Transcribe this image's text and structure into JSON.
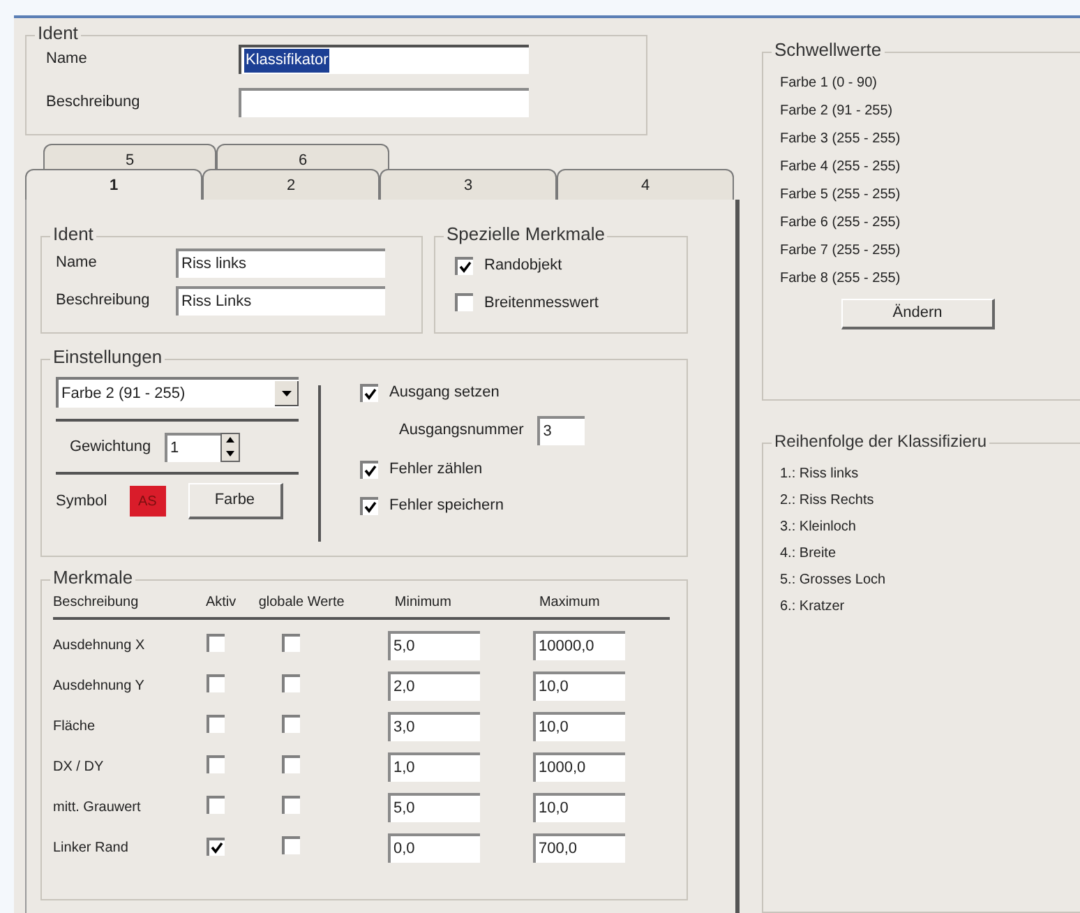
{
  "ident": {
    "title": "Ident",
    "fields": [
      {
        "label": "Name",
        "value": "Klassifikator",
        "selected": true
      },
      {
        "label": "Beschreibung",
        "selected": false
      }
    ]
  },
  "tab_rows": [
    {
      "tabs": [
        {
          "label": "5",
          "selected": false
        },
        {
          "label": "6",
          "selected": false
        }
      ]
    },
    {
      "tabs": [
        {
          "label": "1",
          "selected": true
        },
        {
          "label": "2",
          "selected": false
        },
        {
          "label": "3",
          "selected": false
        },
        {
          "label": "4",
          "selected": false
        }
      ]
    }
  ],
  "panel": {
    "ident": {
      "title": "Ident",
      "fields": [
        {
          "label": "Name",
          "value": "Riss links"
        },
        {
          "label": "Beschreibung",
          "value": "Riss Links"
        }
      ]
    },
    "special": {
      "title": "Spezielle Merkmale",
      "options": [
        {
          "label": "Randobjekt",
          "checked": true
        },
        {
          "label": "Breitenmesswert",
          "checked": false
        }
      ]
    },
    "settings": {
      "title": "Einstellungen",
      "dropdown": {
        "value": "Farbe 2 (91 - 255)"
      },
      "weight": {
        "label": "Gewichtung",
        "value": "1"
      },
      "symbol": {
        "label": "Symbol",
        "text": "AS"
      },
      "color_button": "Farbe",
      "options": [
        {
          "kind": "checkbox",
          "label": "Ausgang setzen",
          "checked": true
        },
        {
          "kind": "number",
          "label": "Ausgangsnummer",
          "value": "3"
        },
        {
          "kind": "checkbox",
          "label": "Fehler zählen",
          "checked": true
        },
        {
          "kind": "checkbox",
          "label": "Fehler speichern",
          "checked": true
        }
      ]
    },
    "features": {
      "title": "Merkmale",
      "columns": [
        "Beschreibung",
        "Aktiv",
        "globale Werte",
        "Minimum",
        "Maximum"
      ],
      "rows": [
        {
          "name": "Ausdehnung X",
          "active": false,
          "global": false,
          "minimum": "5,0",
          "maximum": "10000,0"
        },
        {
          "name": "Ausdehnung Y",
          "active": false,
          "global": false,
          "minimum": "2,0",
          "maximum": "10,0"
        },
        {
          "name": "Fläche",
          "active": false,
          "global": false,
          "minimum": "3,0",
          "maximum": "10,0"
        },
        {
          "name": "DX / DY",
          "active": false,
          "global": false,
          "minimum": "1,0",
          "maximum": "1000,0"
        },
        {
          "name": "mitt. Grauwert",
          "active": false,
          "global": false,
          "minimum": "5,0",
          "maximum": "10,0"
        },
        {
          "name": "Linker Rand",
          "active": true,
          "global": false,
          "minimum": "0,0",
          "maximum": "700,0"
        }
      ]
    }
  },
  "thresholds": {
    "title": "Schwellwerte",
    "items": [
      "Farbe 1 (0 - 90)",
      "Farbe 2 (91 - 255)",
      "Farbe 3 (255 - 255)",
      "Farbe 4 (255 - 255)",
      "Farbe 5 (255 - 255)",
      "Farbe 6 (255 - 255)",
      "Farbe 7 (255 - 255)",
      "Farbe 8 (255 - 255)"
    ],
    "button": "Ändern"
  },
  "order": {
    "title": "Reihenfolge der Klassifizieru",
    "items": [
      "1.: Riss links",
      "2.: Riss Rechts",
      "3.: Kleinloch",
      "4.: Breite",
      "5.: Grosses Loch",
      "6.: Kratzer"
    ]
  }
}
